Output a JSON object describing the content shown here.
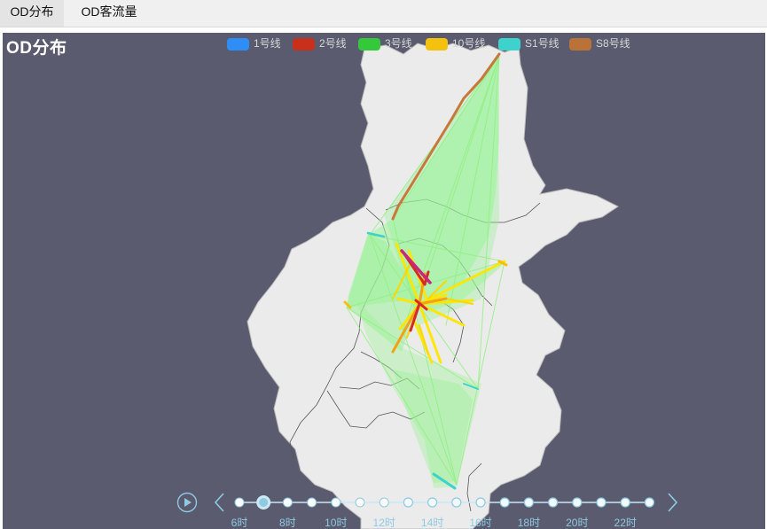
{
  "tabs": [
    {
      "label": "OD分布",
      "active": true
    },
    {
      "label": "OD客流量",
      "active": false
    }
  ],
  "panel": {
    "title": "OD分布",
    "background": "#5a5b6e",
    "legend": [
      {
        "label": "1号线",
        "color": "#2f8ef5"
      },
      {
        "label": "2号线",
        "color": "#c9301c"
      },
      {
        "label": "3号线",
        "color": "#33c93b"
      },
      {
        "label": "10号线",
        "color": "#f4c10f"
      },
      {
        "label": "S1号线",
        "color": "#3dd3cc"
      },
      {
        "label": "S8号线",
        "color": "#b97238"
      }
    ]
  },
  "timeline": {
    "play_icon": "play-icon",
    "prev_icon": "chevron-left-icon",
    "next_icon": "chevron-right-icon",
    "current_index": 1,
    "labels": [
      "6时",
      "8时",
      "10时",
      "12时",
      "14时",
      "16时",
      "18时",
      "20时",
      "22时"
    ],
    "hour_count": 18
  }
}
